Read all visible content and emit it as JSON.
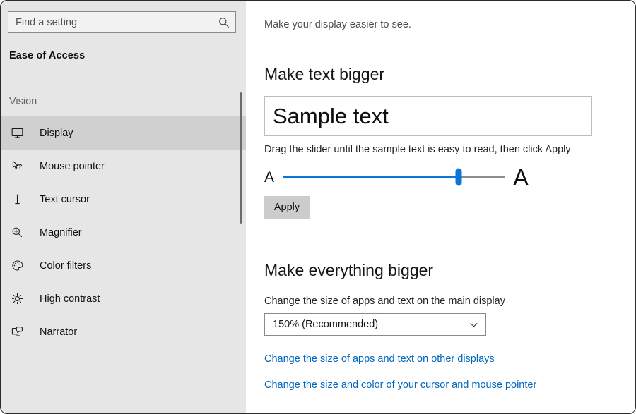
{
  "sidebar": {
    "search": {
      "placeholder": "Find a setting",
      "value": "",
      "icon": "search-icon"
    },
    "app_title": "Ease of Access",
    "group_header": "Vision",
    "items": [
      {
        "label": "Display",
        "icon": "monitor-icon",
        "selected": true
      },
      {
        "label": "Mouse pointer",
        "icon": "mouse-pointer-icon",
        "selected": false
      },
      {
        "label": "Text cursor",
        "icon": "text-cursor-icon",
        "selected": false
      },
      {
        "label": "Magnifier",
        "icon": "magnifier-icon",
        "selected": false
      },
      {
        "label": "Color filters",
        "icon": "palette-icon",
        "selected": false
      },
      {
        "label": "High contrast",
        "icon": "brightness-icon",
        "selected": false
      },
      {
        "label": "Narrator",
        "icon": "narrator-icon",
        "selected": false
      }
    ]
  },
  "main": {
    "subtitle": "Make your display easier to see.",
    "text_section": {
      "title": "Make text bigger",
      "sample_text": "Sample text",
      "hint": "Drag the slider until the sample text is easy to read, then click Apply",
      "slider": {
        "min_label": "A",
        "max_label": "A",
        "value_percent": 79
      },
      "apply_label": "Apply"
    },
    "scale_section": {
      "title": "Make everything bigger",
      "field_label": "Change the size of apps and text on the main display",
      "selected_scale": "150% (Recommended)",
      "chevron_icon": "chevron-down-icon"
    },
    "links": [
      "Change the size of apps and text on other displays",
      "Change the size and color of your cursor and mouse pointer"
    ]
  },
  "colors": {
    "accent": "#0b76d6",
    "link": "#0067c0",
    "sidebar_bg": "#e6e6e6",
    "selected_row": "#d0d0d0"
  }
}
